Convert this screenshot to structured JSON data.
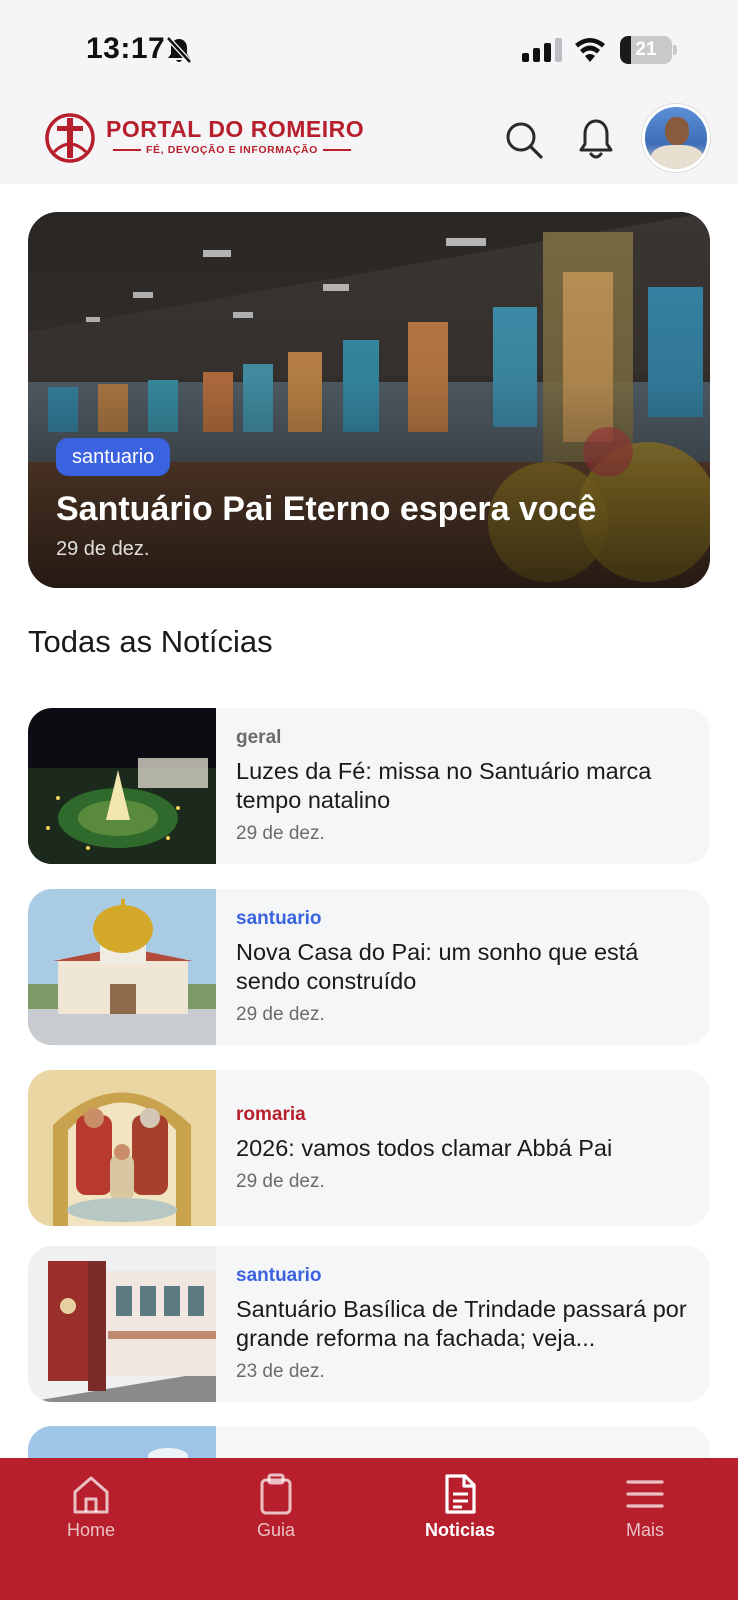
{
  "status_bar": {
    "time": "13:17",
    "battery_level": "21",
    "battery_fraction": 0.21,
    "icons": [
      "bell-slash-icon",
      "cellular-signal-icon",
      "wifi-icon",
      "battery-icon"
    ]
  },
  "header": {
    "logo_title": "PORTAL DO ROMEIRO",
    "logo_tagline": "FÉ, DEVOÇÃO E INFORMAÇÃO",
    "icons": [
      "search-icon",
      "bell-icon"
    ],
    "brand_color": "#b61f2b"
  },
  "hero": {
    "badge": "santuario",
    "title": "Santuário Pai Eterno espera você",
    "date": "29 de dez.",
    "badge_color": "#3b63e0"
  },
  "section": {
    "title": "Todas as Notícias"
  },
  "news": [
    {
      "category": "geral",
      "category_color": "#6b6b6b",
      "title": "Luzes da Fé: missa no Santuário marca tempo natalino",
      "date": "29 de dez."
    },
    {
      "category": "santuario",
      "category_color": "#3b63e0",
      "title": "Nova Casa do Pai: um sonho que está sendo construído",
      "date": "29 de dez."
    },
    {
      "category": "romaria",
      "category_color": "#b61f2b",
      "title": "2026: vamos todos clamar Abbá Pai",
      "date": "29 de dez."
    },
    {
      "category": "santuario",
      "category_color": "#3b63e0",
      "title": "Santuário Basílica de Trindade passará por grande reforma na fachada; veja...",
      "date": "23 de dez."
    }
  ],
  "bottom_nav": {
    "items": [
      {
        "label": "Home",
        "icon": "home-icon"
      },
      {
        "label": "Guia",
        "icon": "clipboard-icon"
      },
      {
        "label": "Noticias",
        "icon": "document-icon",
        "active": true
      },
      {
        "label": "Mais",
        "icon": "menu-icon"
      }
    ],
    "background": "#b61f2b"
  }
}
